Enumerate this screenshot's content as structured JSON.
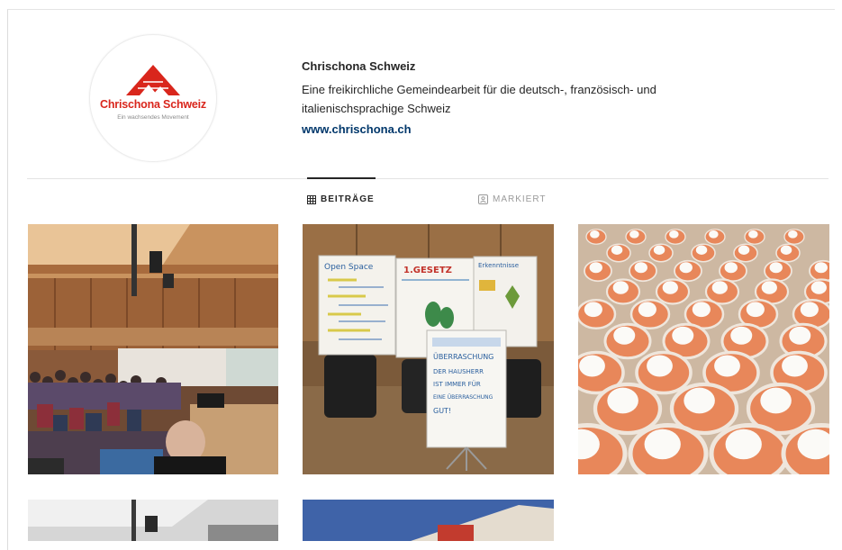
{
  "profile": {
    "logo_name": "Chrischona Schweiz",
    "logo_tagline": "Ein wachsendes Movement",
    "name": "Chrischona Schweiz",
    "bio": "Eine freikirchliche Gemeindearbeit für die deutsch-, französisch- und italienischsprachige Schweiz",
    "website": "www.chrischona.ch"
  },
  "tabs": [
    {
      "label": "BEITRÄGE",
      "icon": "grid-icon",
      "active": true
    },
    {
      "label": "MARKIERT",
      "icon": "tagged-icon",
      "active": false
    }
  ],
  "posts": {
    "flipcharts": {
      "chart1_title": "Open Space",
      "chart2_title": "1.GESETZ",
      "chart3_title": "Erkenntnisse",
      "board_note": "ÜBERRASCHUNG",
      "board_lines": [
        "DER HAUSHERR",
        "IST IMMER FÜR",
        "EINE ÜBERRASCHUNG",
        "GUT!"
      ]
    }
  },
  "colors": {
    "brand_red": "#d9261c",
    "text_primary": "#262626",
    "link": "#00376b",
    "muted": "#9a9a9a",
    "divider": "#e3e3e3"
  }
}
